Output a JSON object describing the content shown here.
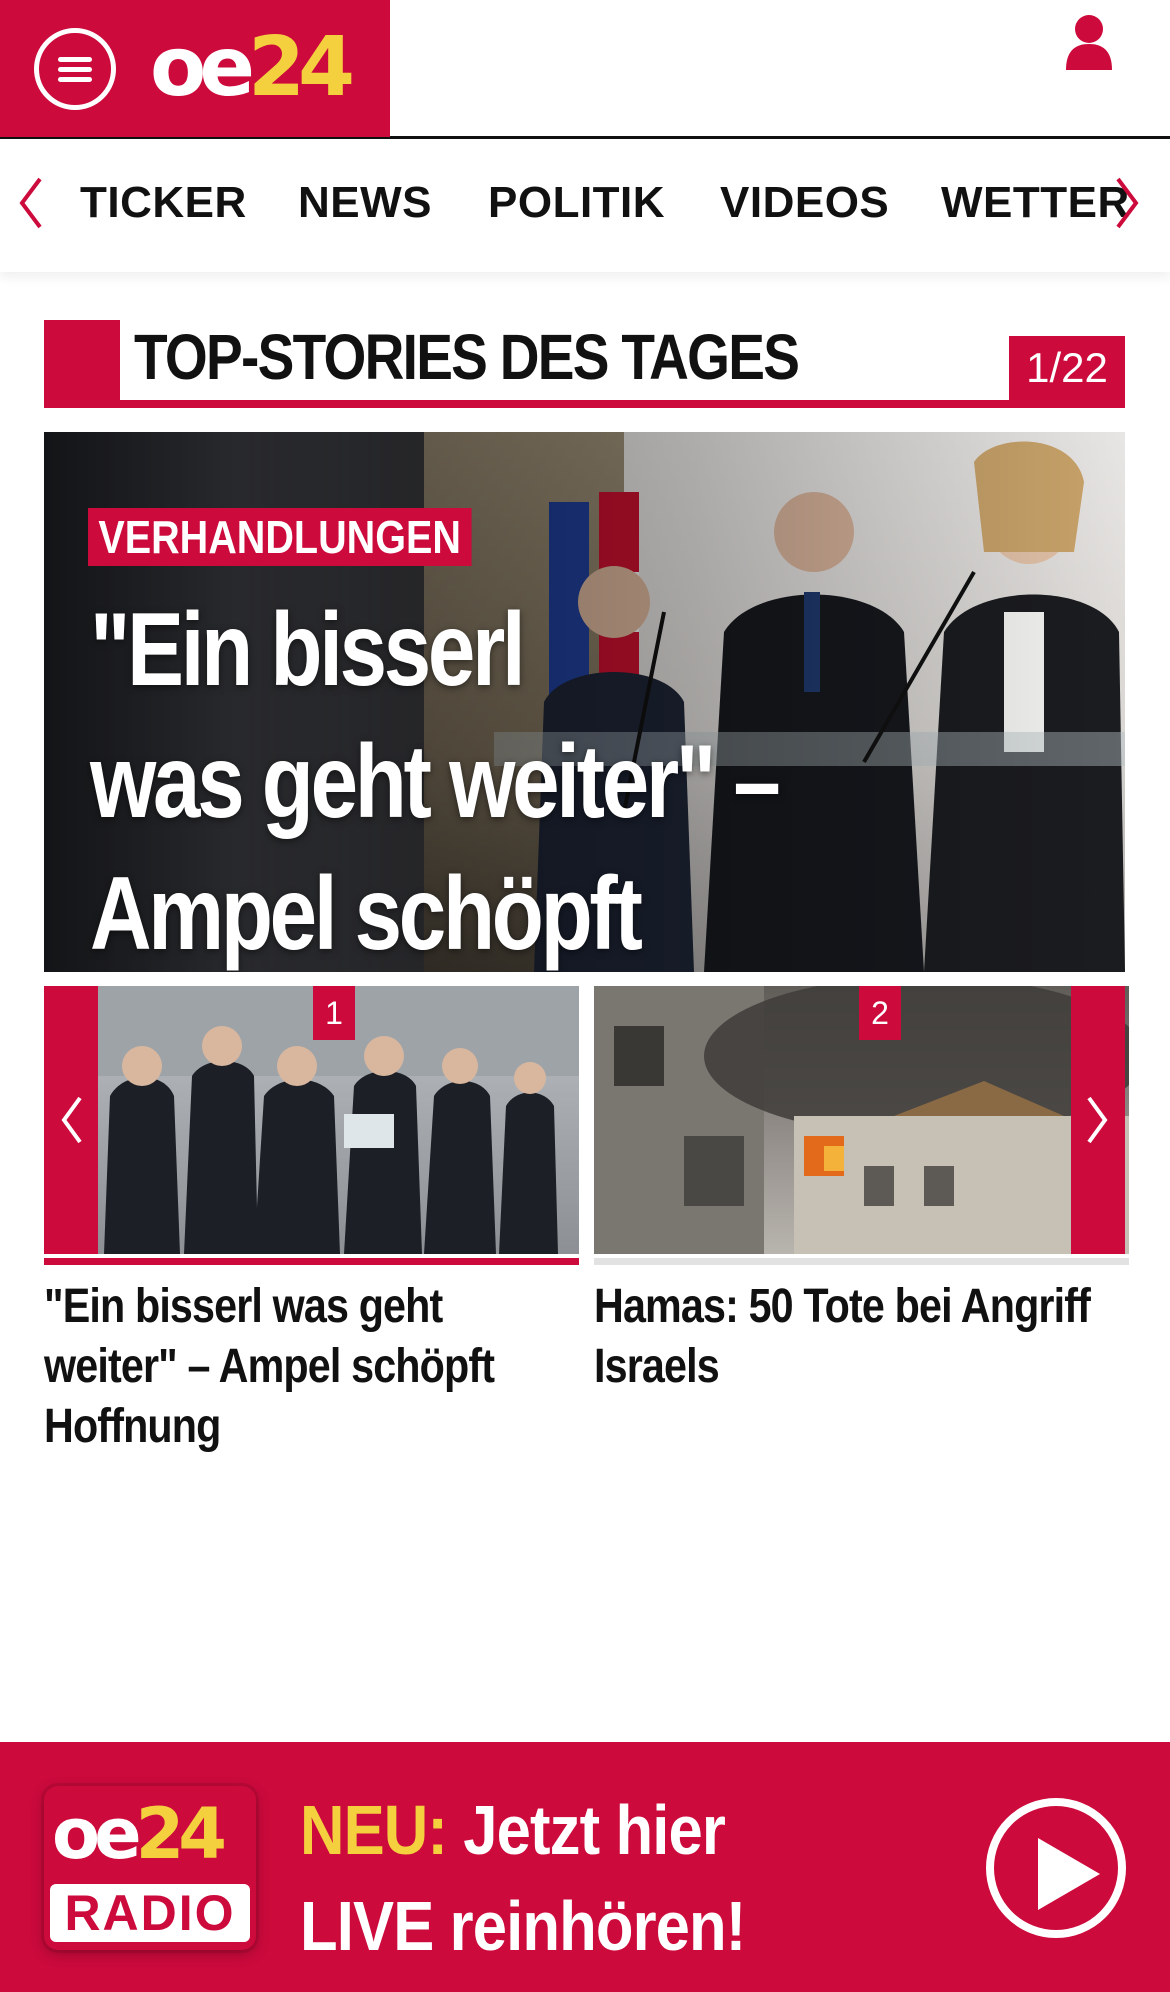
{
  "brand": {
    "logo_oe": "oe",
    "logo_num": "24"
  },
  "header": {
    "menu_icon": "hamburger-menu-icon",
    "user_icon": "user-icon"
  },
  "nav": {
    "items": [
      "TICKER",
      "NEWS",
      "POLITIK",
      "VIDEOS",
      "WETTER"
    ]
  },
  "section": {
    "title": "TOP-STORIES DES TAGES",
    "counter": "1/22"
  },
  "hero": {
    "tag": "VERHANDLUNGEN",
    "headline_line1": "\"Ein bisserl",
    "headline_line2": "was geht weiter\" –",
    "headline_line3": "Ampel schöpft Hoffnung"
  },
  "carousel": {
    "items": [
      {
        "number": "1",
        "caption": "\"Ein bisserl was geht weiter\" – Ampel schöpft Hoffnung"
      },
      {
        "number": "2",
        "caption": "Hamas: 50 Tote bei Angriff Israels"
      }
    ]
  },
  "radio": {
    "logo_oe": "oe",
    "logo_num": "24",
    "logo_label": "RADIO",
    "neu": "NEU:",
    "line1": " Jetzt hier",
    "line2": "LIVE reinhören!"
  },
  "colors": {
    "brand_red": "#cc0a3c",
    "brand_yellow": "#f4d03f"
  }
}
